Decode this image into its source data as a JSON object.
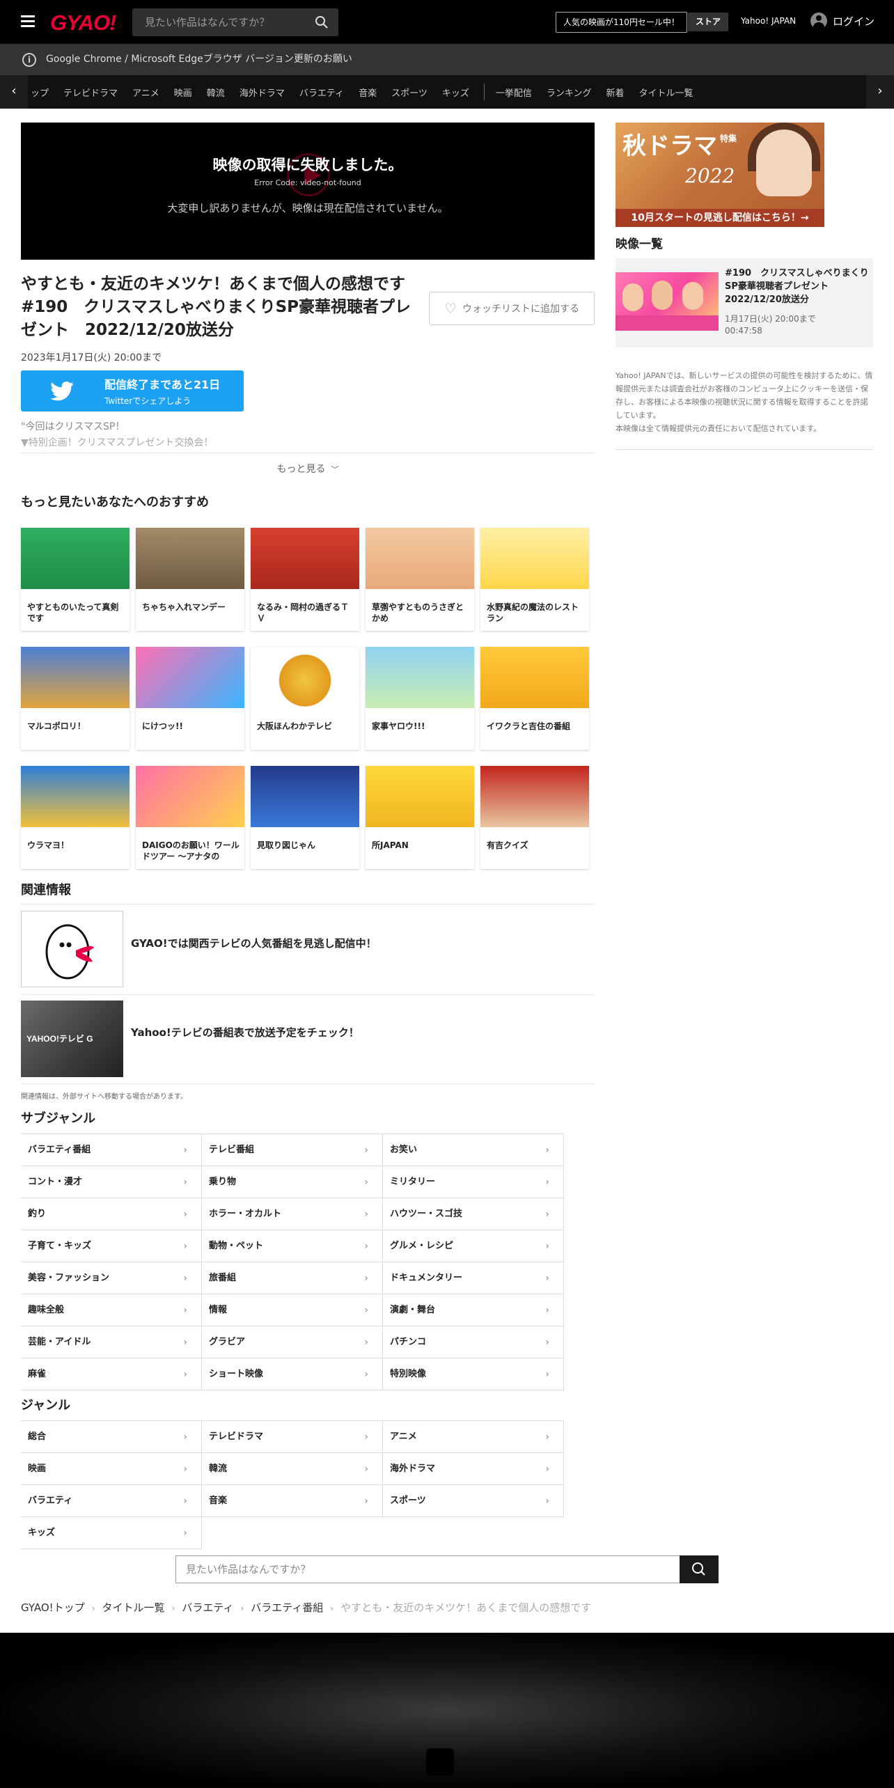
{
  "header": {
    "logo": "GYAO!",
    "search_placeholder": "見たい作品はなんですか？",
    "promo": "人気の映画が110円セール中！",
    "store": "ストア",
    "yahoo_japan": "Yahoo! JAPAN",
    "login": "ログイン"
  },
  "notice": "Google Chrome / Microsoft Edgeブラウザ バージョン更新のお願い",
  "nav": {
    "items": [
      "ップ",
      "テレビドラマ",
      "アニメ",
      "映画",
      "韓流",
      "海外ドラマ",
      "バラエティ",
      "音楽",
      "スポーツ",
      "キッズ"
    ],
    "items2": [
      "一挙配信",
      "ランキング",
      "新着",
      "タイトル一覧"
    ]
  },
  "player": {
    "error_title": "映像の取得に失敗しました。",
    "error_code": "Error Code: video-not-found",
    "error_message": "大変申し訳ありませんが、映像は現在配信されていません。"
  },
  "video": {
    "title": "やすとも・友近のキメツケ！あくまで個人の感想です　#190　クリスマスしゃべりまくりSP豪華視聴者プレゼント　2022/12/20放送分",
    "watchlist": "ウォッチリストに追加する",
    "date": "2023年1月17日(火) 20:00まで",
    "twitter_main": "配信終了まであと21日",
    "twitter_sub": "Twitterでシェアしよう",
    "desc1": "\"今回はクリスマスSP！",
    "desc2": "▼特別企画！クリスマスプレゼント交換会！",
    "more": "もっと見る"
  },
  "recommend": {
    "heading": "もっと見たいあなたへのおすすめ",
    "items": [
      {
        "title": "やすとものいたって真剣です"
      },
      {
        "title": "ちゃちゃ入れマンデー"
      },
      {
        "title": "なるみ・岡村の過ぎるＴＶ"
      },
      {
        "title": "草彅やすとものうさぎとかめ"
      },
      {
        "title": "水野真紀の魔法のレストラン"
      },
      {
        "title": "マルコポロリ！"
      },
      {
        "title": "にけつッ!!"
      },
      {
        "title": "大阪ほんわかテレビ"
      },
      {
        "title": "家事ヤロウ!!!"
      },
      {
        "title": "イワクラと吉住の番組"
      },
      {
        "title": "ウラマヨ！"
      },
      {
        "title": "DAIGOのお願い！ワールドツアー 〜アナタの"
      },
      {
        "title": "見取り図じゃん"
      },
      {
        "title": "所JAPAN"
      },
      {
        "title": "有吉クイズ"
      }
    ]
  },
  "related": {
    "heading": "関連情報",
    "items": [
      {
        "text": "GYAO!では関西テレビの人気番組を見逃し配信中！"
      },
      {
        "text": "Yahoo!テレビの番組表で放送予定をチェック！",
        "logo": "YAHOO!テレビ G"
      }
    ],
    "note": "関連情報は、外部サイトへ移動する場合があります。"
  },
  "subgenre": {
    "heading": "サブジャンル",
    "items": [
      "バラエティ番組",
      "テレビ番組",
      "お笑い",
      "コント・漫才",
      "乗り物",
      "ミリタリー",
      "釣り",
      "ホラー・オカルト",
      "ハウツー・スゴ技",
      "子育て・キッズ",
      "動物・ペット",
      "グルメ・レシピ",
      "美容・ファッション",
      "旅番組",
      "ドキュメンタリー",
      "趣味全般",
      "情報",
      "演劇・舞台",
      "芸能・アイドル",
      "グラビア",
      "パチンコ",
      "麻雀",
      "ショート映像",
      "特別映像"
    ]
  },
  "genre": {
    "heading": "ジャンル",
    "items": [
      "総合",
      "テレビドラマ",
      "アニメ",
      "映画",
      "韓流",
      "海外ドラマ",
      "バラエティ",
      "音楽",
      "スポーツ",
      "キッズ"
    ]
  },
  "bottom_search": {
    "placeholder": "見たい作品はなんですか？"
  },
  "breadcrumb": {
    "items": [
      "GYAO!トップ",
      "タイトル一覧",
      "バラエティ",
      "バラエティ番組"
    ],
    "current": "やすとも・友近のキメツケ！あくまで個人の感想です"
  },
  "sidebar": {
    "banner": {
      "title": "秋ドラマ",
      "tokushu": "特集",
      "year": "2022",
      "bar": "10月スタートの見逃し配信はこちら！→"
    },
    "heading": "映像一覧",
    "episode": {
      "title": "#190　クリスマスしゃべりまくりSP豪華視聴者プレゼント　2022/12/20放送分",
      "date": "1月17日(火) 20:00まで",
      "duration": "00:47:58"
    },
    "text": "Yahoo! JAPANでは、新しいサービスの提供の可能性を検討するために、情報提供元または調査会社がお客様のコンピュータ上にクッキーを送信・保存し、お客様による本映像の視聴状況に関する情報を取得することを許諾しています。\n本映像は全て情報提供元の責任において配信されています。"
  },
  "colors": {
    "brand": "#e60033",
    "twitter": "#1da1f2"
  }
}
